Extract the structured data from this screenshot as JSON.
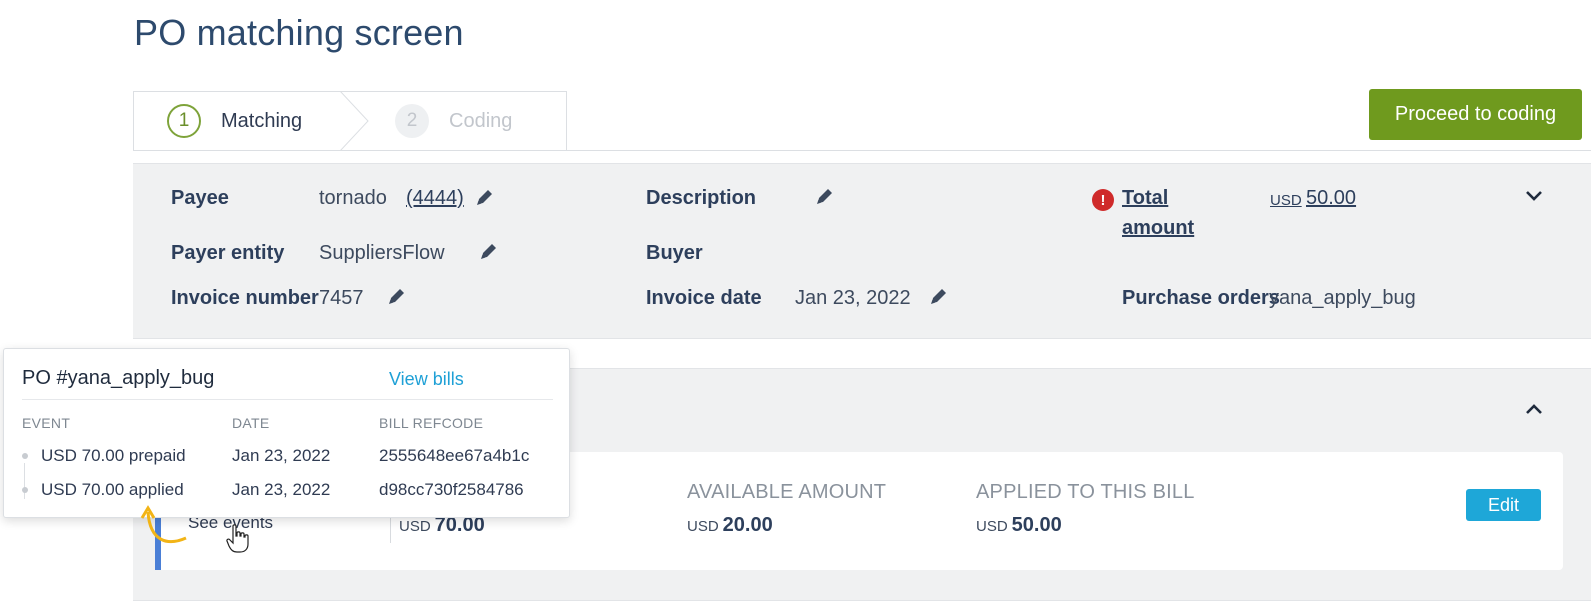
{
  "page": {
    "title": "PO matching screen"
  },
  "stepper": {
    "steps": [
      {
        "number": "1",
        "label": "Matching"
      },
      {
        "number": "2",
        "label": "Coding"
      }
    ]
  },
  "actions": {
    "proceed_label": "Proceed to coding"
  },
  "header": {
    "payee_label": "Payee",
    "payee_value": "tornado",
    "payee_code": "(4444)",
    "payer_entity_label": "Payer entity",
    "payer_entity_value": "SuppliersFlow",
    "invoice_number_label": "Invoice number",
    "invoice_number_value": "7457",
    "description_label": "Description",
    "buyer_label": "Buyer",
    "invoice_date_label": "Invoice date",
    "invoice_date_value": "Jan 23, 2022",
    "total_label_line1": "Total",
    "total_label_line2": "amount",
    "total_currency": "USD",
    "total_value": "50.00",
    "purchase_orders_label": "Purchase orders",
    "purchase_orders_value": "yana_apply_bug",
    "info_icon": "!"
  },
  "po_card": {
    "see_events": "See events",
    "po_amount_currency": "USD",
    "po_amount_value": "70.00",
    "available_label": "AVAILABLE AMOUNT",
    "available_currency": "USD",
    "available_value": "20.00",
    "applied_label": "APPLIED TO THIS BILL",
    "applied_currency": "USD",
    "applied_value": "50.00",
    "edit_label": "Edit"
  },
  "popover": {
    "title": "PO #yana_apply_bug",
    "view_bills": "View bills",
    "columns": [
      "EVENT",
      "DATE",
      "BILL REFCODE"
    ],
    "rows": [
      {
        "event": "USD 70.00 prepaid",
        "date": "Jan 23, 2022",
        "refcode": "2555648ee67a4b1c"
      },
      {
        "event": "USD 70.00 applied",
        "date": "Jan 23, 2022",
        "refcode": "d98cc730f2584786"
      }
    ]
  },
  "colors": {
    "brand_green": "#6f9a1e",
    "accent_blue": "#1ea7d8",
    "error_red": "#cf2a2a",
    "arrow_yellow": "#f2b416"
  }
}
